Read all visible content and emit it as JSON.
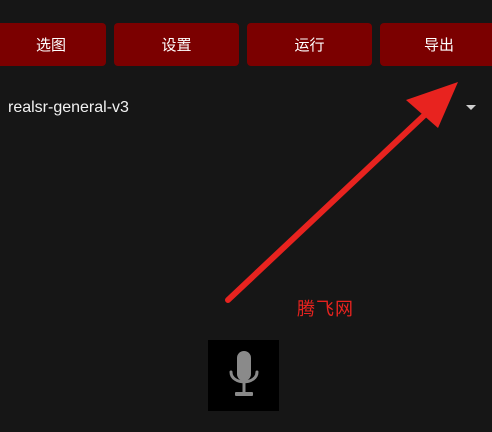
{
  "toolbar": {
    "buttons": [
      {
        "label": "选图"
      },
      {
        "label": "设置"
      },
      {
        "label": "运行"
      },
      {
        "label": "导出"
      }
    ]
  },
  "model_select": {
    "value": "realsr-general-v3"
  },
  "watermark": {
    "text": "腾飞网"
  },
  "colors": {
    "background": "#161616",
    "button": "#7b0000",
    "annotation": "#e8231f"
  },
  "icons": {
    "dropdown": "chevron-down-icon",
    "mic": "microphone-icon"
  }
}
